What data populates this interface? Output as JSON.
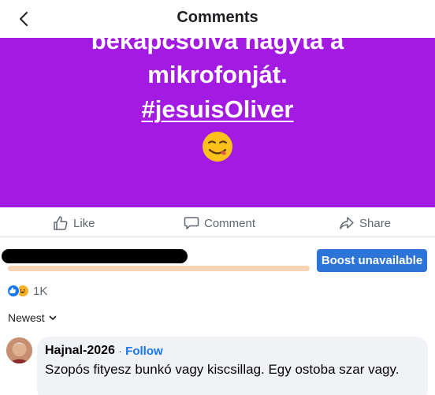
{
  "header": {
    "title": "Comments"
  },
  "post": {
    "line1": "bekapcsolva hagyta a",
    "line2": "mikrofonját.",
    "hashtag": "#jesuisOliver",
    "background_color": "#a31ae2",
    "emoji": "smirk-face-emoji"
  },
  "actions": {
    "like_label": "Like",
    "comment_label": "Comment",
    "share_label": "Share"
  },
  "boost": {
    "label": "Boost unavailable",
    "progress_fraction": 0.7
  },
  "reactions": {
    "count": "1K",
    "types": [
      "like",
      "haha"
    ]
  },
  "sort": {
    "label": "Newest"
  },
  "comment": {
    "author": "Hajnal-2026",
    "separator": "·",
    "follow_label": "Follow",
    "text": "Szopós fityesz bunkó vagy kiscsillag. Egy ostoba szar vagy."
  },
  "colors": {
    "accent": "#1877f2",
    "boost_button": "#2d74d9",
    "muted_text": "#606770"
  }
}
